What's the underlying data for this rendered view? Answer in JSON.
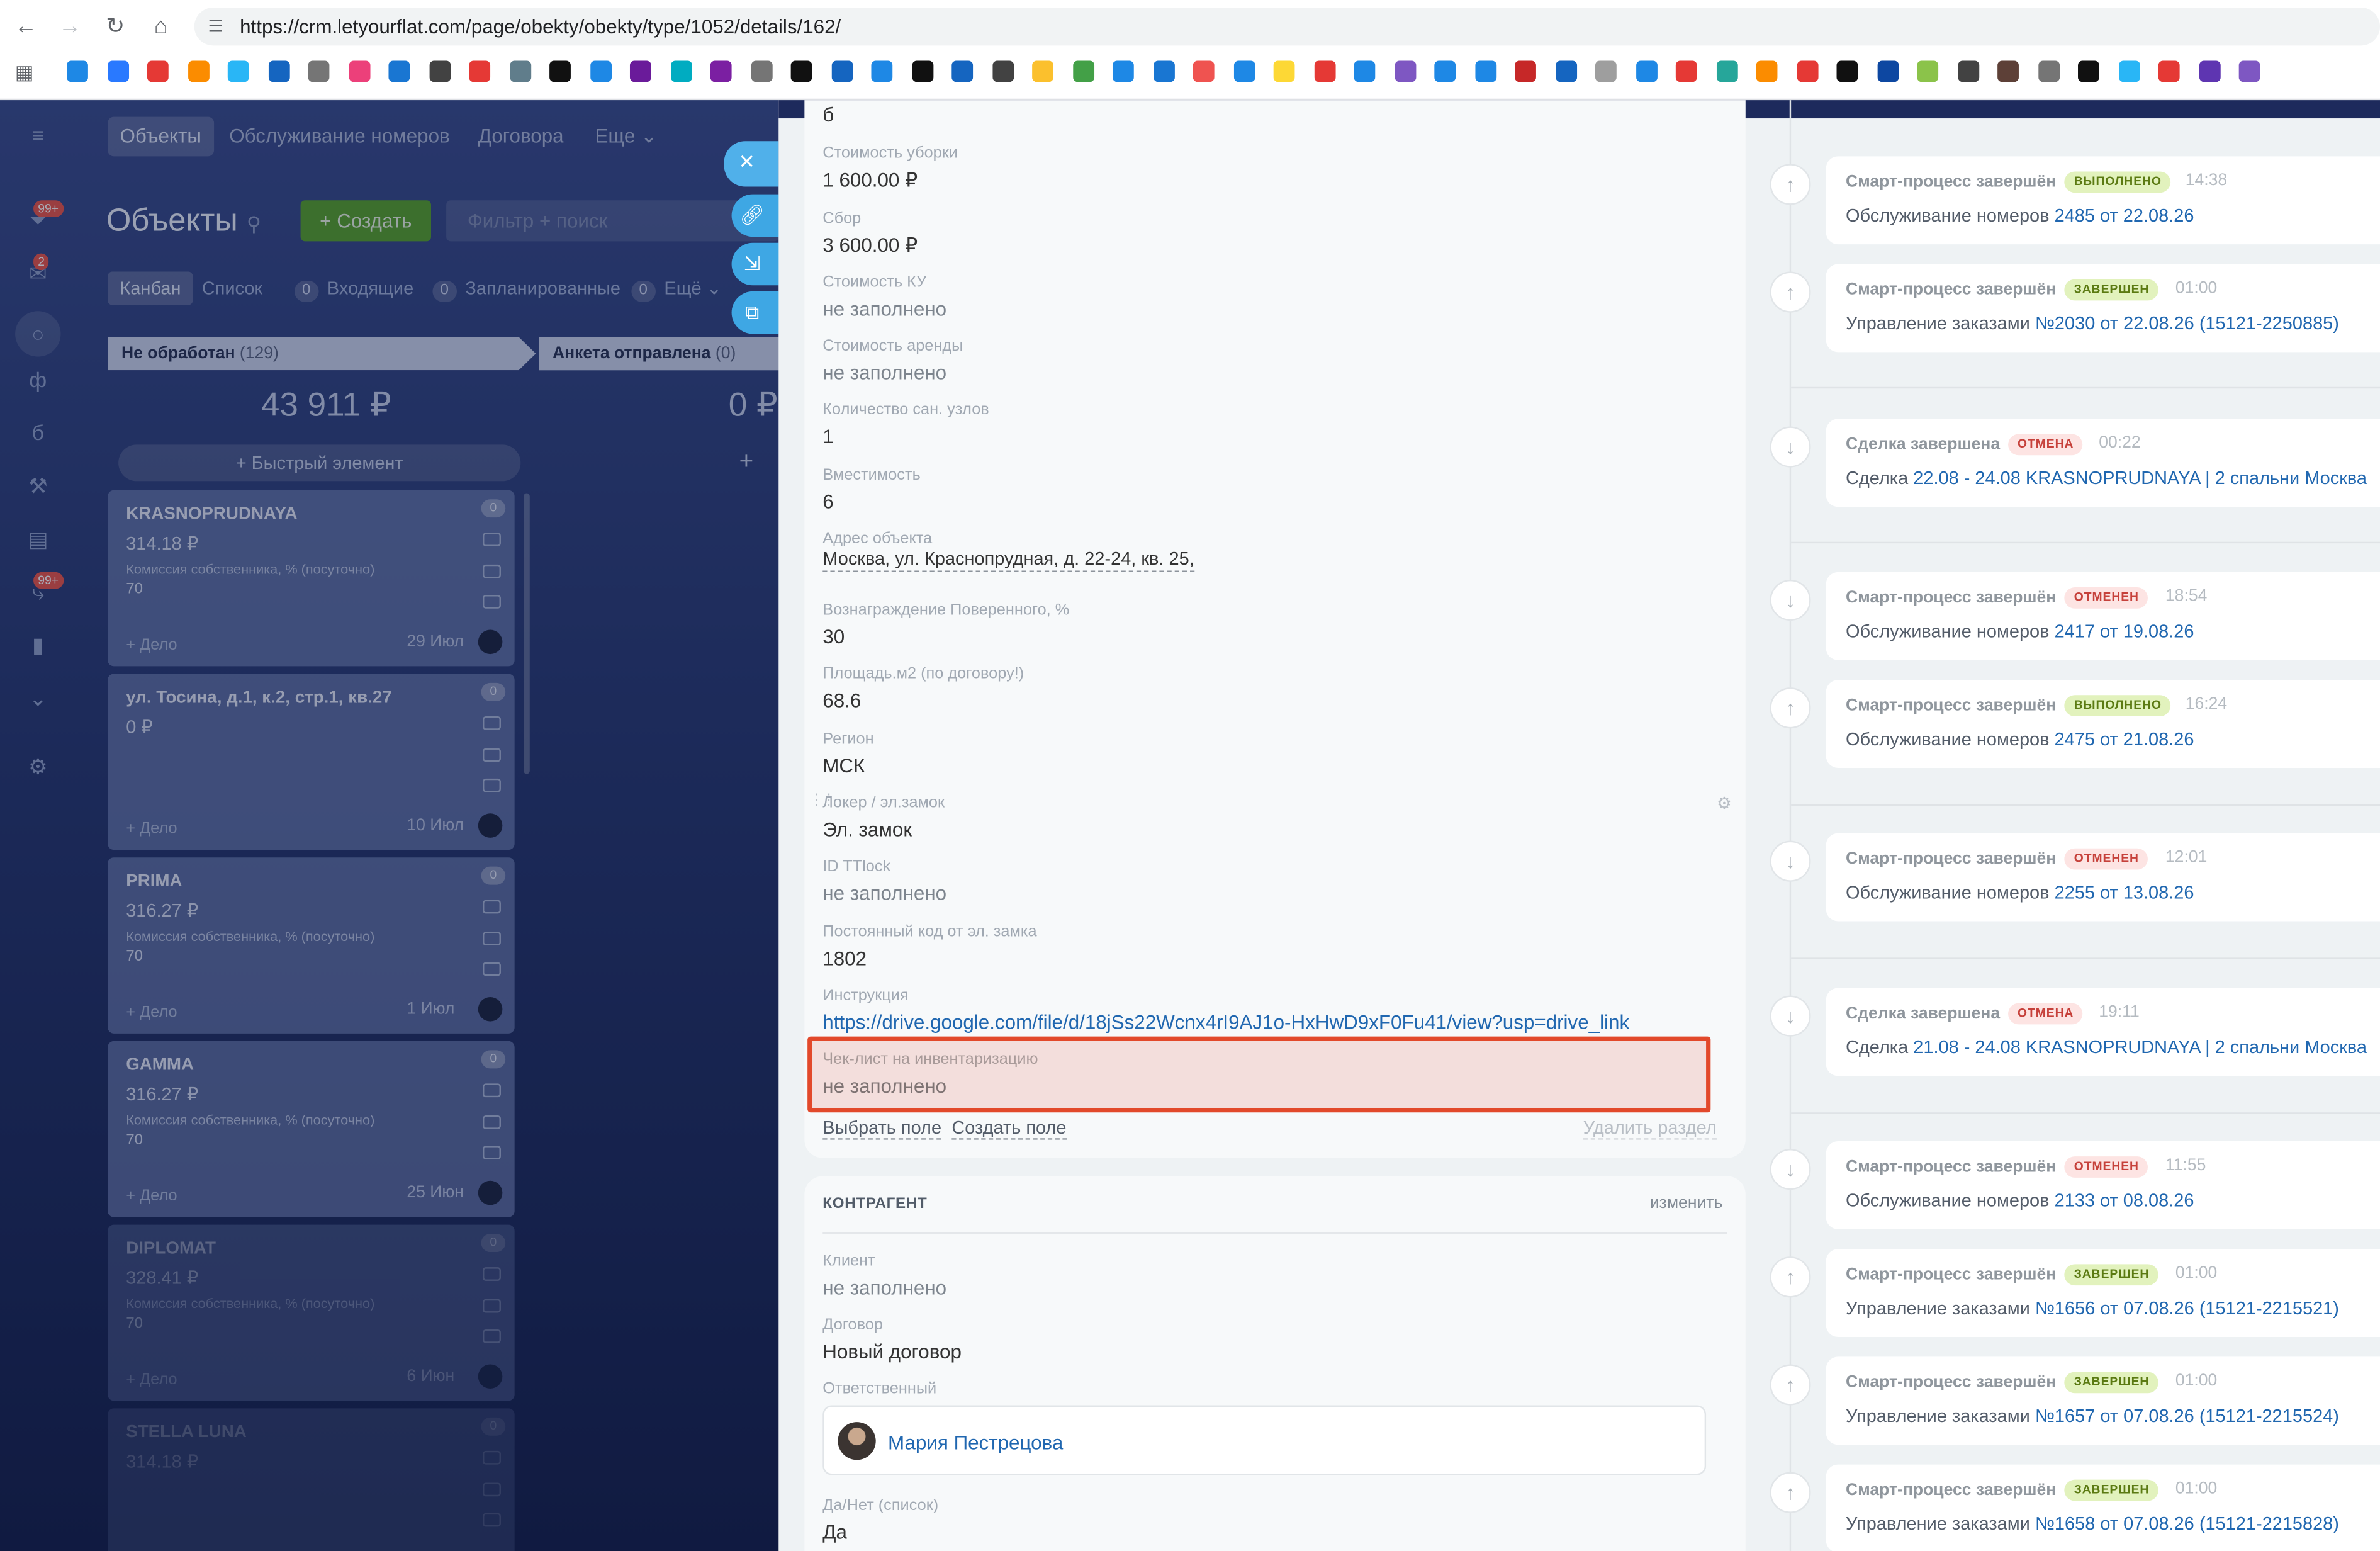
{
  "browser": {
    "url": "https://crm.letyourflat.com/page/obekty/obekty/type/1052/details/162/"
  },
  "nav": {
    "objects": "Объекты",
    "service": "Обслуживание номеров",
    "contracts": "Договора",
    "more": "Еще"
  },
  "rail": {
    "badge1": "99+",
    "badge2": "2",
    "badge3": "99+"
  },
  "page": {
    "title": "Объекты",
    "create": "Создать",
    "filter_placeholder": "Фильтр + поиск"
  },
  "views": {
    "kanban": "Канбан",
    "list": "Список",
    "incoming_count": "0",
    "incoming": "Входящие",
    "planned_count": "0",
    "planned": "Запланированные",
    "more_count": "0",
    "more": "Ещё"
  },
  "columns": [
    {
      "name": "Не обработан",
      "count": "(129)",
      "sum": "43 911 ₽",
      "quick_add": "Быстрый элемент"
    },
    {
      "name": "Анкета отправлена",
      "count": "(0)",
      "sum": "0 ₽"
    }
  ],
  "cards": [
    {
      "title": "KRASNOPRUDNAYA",
      "price": "314.18 ₽",
      "commission_label": "Комиссия собственника, % (посуточно)",
      "commission": "70",
      "deal": "+ Дело",
      "date": "29 Июл",
      "counter": "0"
    },
    {
      "title": "ул. Тосина, д.1, к.2, стр.1, кв.27",
      "price": "0 ₽",
      "commission_label": "",
      "commission": "",
      "deal": "+ Дело",
      "date": "10 Июл",
      "counter": "0"
    },
    {
      "title": "PRIMA",
      "price": "316.27 ₽",
      "commission_label": "Комиссия собственника, % (посуточно)",
      "commission": "70",
      "deal": "+ Дело",
      "date": "1 Июл",
      "counter": "0"
    },
    {
      "title": "GAMMA",
      "price": "316.27 ₽",
      "commission_label": "Комиссия собственника, % (посуточно)",
      "commission": "70",
      "deal": "+ Дело",
      "date": "25 Июн",
      "counter": "0"
    },
    {
      "title": "DIPLOMAT",
      "price": "328.41 ₽",
      "commission_label": "Комиссия собственника, % (посуточно)",
      "commission": "70",
      "deal": "+ Дело",
      "date": "6 Июн",
      "counter": "0"
    },
    {
      "title": "STELLA LUNA",
      "price": "314.18 ₽",
      "counter": "0"
    }
  ],
  "fields": [
    {
      "label": "Стоимость уборки",
      "value": "1 600.00 ₽"
    },
    {
      "label": "Сбор",
      "value": "3 600.00 ₽"
    },
    {
      "label": "Стоимость КУ",
      "value": "не заполнено"
    },
    {
      "label": "Стоимость аренды",
      "value": "не заполнено"
    },
    {
      "label": "Количество сан. узлов",
      "value": "1"
    },
    {
      "label": "Вместимость",
      "value": "6"
    },
    {
      "label": "Адрес объекта",
      "value": "Москва, ул. Краснопрудная, д. 22-24, кв. 25,"
    },
    {
      "label": "Вознаграждение Поверенного, %",
      "value": "30"
    },
    {
      "label": "Площадь.м2 (по договору!)",
      "value": "68.6"
    },
    {
      "label": "Регион",
      "value": "МСК"
    },
    {
      "label": "Локер / эл.замок",
      "value": "Эл. замок"
    },
    {
      "label": "ID TTlock",
      "value": "не заполнено"
    },
    {
      "label": "Постоянный код от эл. замка",
      "value": "1802"
    },
    {
      "label": "Инструкция",
      "value": "https://drive.google.com/file/d/18jSs22Wcnx4rI9AJ1o-HxHwD9xF0Fu41/view?usp=drive_link"
    },
    {
      "label": "Чек-лист на инвентаризацию",
      "value": "не заполнено"
    }
  ],
  "field_actions": {
    "select": "Выбрать поле",
    "create": "Создать поле",
    "delete": "Удалить раздел"
  },
  "contractor": {
    "section": "КОНТРАГЕНТ",
    "change": "изменить",
    "client_label": "Клиент",
    "client_value": "не заполнено",
    "contract_label": "Договор",
    "contract_value": "Новый договор",
    "responsible_label": "Ответственный",
    "responsible_name": "Мария Пестрецова",
    "yesno_label": "Да/Нет (список)",
    "yesno_value": "Да"
  },
  "timeline": [
    {
      "dir": "up",
      "title": "Смарт-процесс завершён",
      "badge": "ВЫПОЛНЕНО",
      "badge_type": "green",
      "time": "14:38",
      "prefix": "Обслуживание номеров",
      "link": "2485 от 22.08.26"
    },
    {
      "dir": "up",
      "title": "Смарт-процесс завершён",
      "badge": "ЗАВЕРШЕН",
      "badge_type": "green",
      "time": "01:00",
      "prefix": "Управление заказами",
      "link": "№2030 от 22.08.26 (15121-2250885)"
    },
    {
      "dir": "down",
      "title": "Сделка завершена",
      "badge": "ОТМЕНА",
      "badge_type": "red",
      "time": "00:22",
      "prefix": "Сделка",
      "link": "22.08 - 24.08 KRASNOPRUDNAYA | 2 спальни Москва"
    },
    {
      "dir": "down",
      "title": "Смарт-процесс завершён",
      "badge": "ОТМЕНЕН",
      "badge_type": "red",
      "time": "18:54",
      "prefix": "Обслуживание номеров",
      "link": "2417 от 19.08.26"
    },
    {
      "dir": "up",
      "title": "Смарт-процесс завершён",
      "badge": "ВЫПОЛНЕНО",
      "badge_type": "green",
      "time": "16:24",
      "prefix": "Обслуживание номеров",
      "link": "2475 от 21.08.26"
    },
    {
      "dir": "down",
      "title": "Смарт-процесс завершён",
      "badge": "ОТМЕНЕН",
      "badge_type": "red",
      "time": "12:01",
      "prefix": "Обслуживание номеров",
      "link": "2255 от 13.08.26"
    },
    {
      "dir": "down",
      "title": "Сделка завершена",
      "badge": "ОТМЕНА",
      "badge_type": "red",
      "time": "19:11",
      "prefix": "Сделка",
      "link": "21.08 - 24.08 KRASNOPRUDNAYA | 2 спальни Москва"
    },
    {
      "dir": "down",
      "title": "Смарт-процесс завершён",
      "badge": "ОТМЕНЕН",
      "badge_type": "red",
      "time": "11:55",
      "prefix": "Обслуживание номеров",
      "link": "2133 от 08.08.26"
    },
    {
      "dir": "up",
      "title": "Смарт-процесс завершён",
      "badge": "ЗАВЕРШЕН",
      "badge_type": "green",
      "time": "01:00",
      "prefix": "Управление заказами",
      "link": "№1656 от 07.08.26 (15121-2215521)"
    },
    {
      "dir": "up",
      "title": "Смарт-процесс завершён",
      "badge": "ЗАВЕРШЕН",
      "badge_type": "green",
      "time": "01:00",
      "prefix": "Управление заказами",
      "link": "№1657 от 07.08.26 (15121-2215524)"
    },
    {
      "dir": "up",
      "title": "Смарт-процесс завершён",
      "badge": "ЗАВЕРШЕН",
      "badge_type": "green",
      "time": "01:00",
      "prefix": "Управление заказами",
      "link": "№1658 от 07.08.26 (15121-2215828)"
    }
  ]
}
